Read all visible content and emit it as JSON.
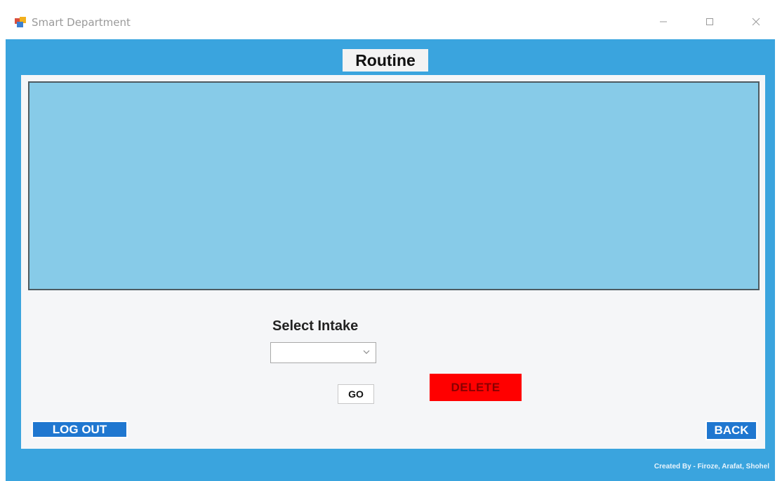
{
  "window": {
    "title": "Smart Department",
    "icon": "app-window-icon",
    "controls": [
      "minimize-icon",
      "maximize-icon",
      "close-icon"
    ]
  },
  "colors": {
    "frame": "#3aa4de",
    "panel": "#f5f6f8",
    "grid": "#87cbe8",
    "delete": "#ff0000",
    "nav_button": "#1f77d0"
  },
  "page": {
    "title": "Routine"
  },
  "intake": {
    "label": "Select Intake",
    "selected_value": ""
  },
  "buttons": {
    "go": "GO",
    "delete": "DELETE",
    "logout": "LOG OUT",
    "back": "BACK"
  },
  "footer": {
    "credits": "Created By - Firoze, Arafat, Shohel"
  }
}
